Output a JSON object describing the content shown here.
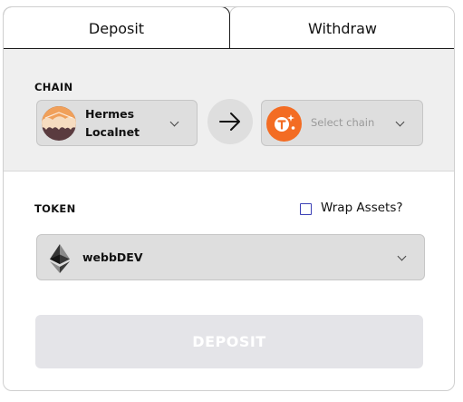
{
  "tabs": {
    "deposit_label": "Deposit",
    "withdraw_label": "Withdraw",
    "active": "Deposit"
  },
  "chain": {
    "section_label": "CHAIN",
    "source": {
      "name_line1": "Hermes",
      "name_line2": "Localnet",
      "icon": "hermes-chain-icon"
    },
    "arrow_icon": "arrow-right-icon",
    "destination": {
      "placeholder": "Select chain",
      "icon": "tangle-chain-icon",
      "icon_color": "#f36c23"
    }
  },
  "token": {
    "section_label": "TOKEN",
    "wrap_label": "Wrap Assets?",
    "wrap_checked": false,
    "selected": "webbDEV",
    "icon": "ethereum-icon"
  },
  "action": {
    "deposit_label": "DEPOSIT",
    "disabled": true
  },
  "colors": {
    "accent": "#3a3fb5",
    "chain_section_bg": "#efefef",
    "select_bg": "#dedede",
    "button_disabled_bg": "#e4e4e8"
  }
}
